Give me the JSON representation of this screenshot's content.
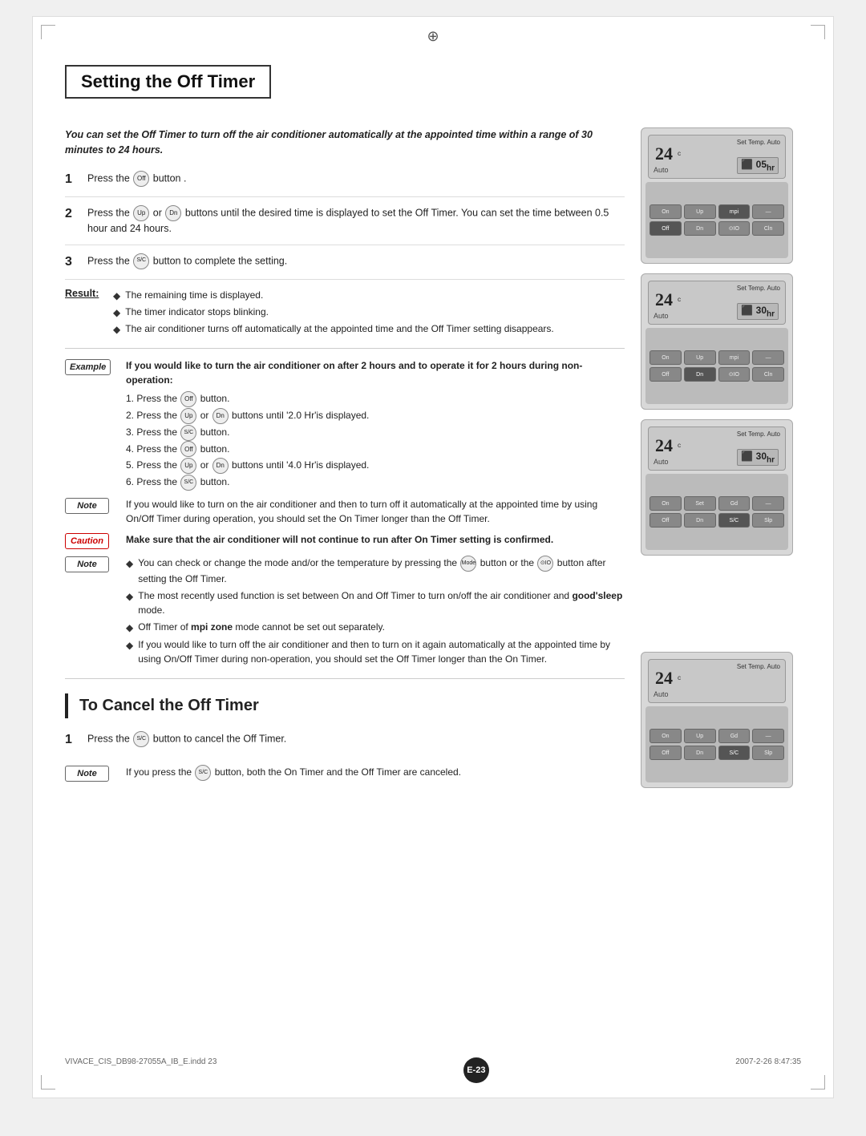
{
  "page": {
    "top_dot": "⊕",
    "section1": {
      "title": "Setting the Off Timer",
      "intro": "You can set the Off Timer to turn off the air conditioner automatically at the appointed time within a range of 30 minutes to 24 hours.",
      "steps": [
        {
          "num": "1",
          "text": "Press the  button ."
        },
        {
          "num": "2",
          "text": "Press the  or  buttons until the desired time is displayed to set the Off Timer. You can set the time between 0.5 hour and 24 hours."
        },
        {
          "num": "3",
          "text": "Press the  button to complete the setting."
        }
      ],
      "result_label": "Result:",
      "result_items": [
        "The remaining time is displayed.",
        "The timer indicator stops blinking.",
        "The air conditioner turns off automatically at the appointed time and the Off Timer setting disappears."
      ],
      "example_label": "Example",
      "example_title": "If you would like to turn the air conditioner on after 2 hours and to operate it for 2 hours during non-operation:",
      "example_steps": [
        "1. Press the  button.",
        "2. Press the  or  buttons until '2.0 Hr'is displayed.",
        "3. Press the  button.",
        "4. Press the  button.",
        "5. Press the  or  buttons until '4.0 Hr'is displayed.",
        "6. Press the  button."
      ],
      "note1_label": "Note",
      "note1_text": "If you would like to turn on the air conditioner and then to turn off it automatically at the appointed time by using On/Off Timer during operation, you should set the On Timer longer than the Off Timer.",
      "caution_label": "Caution",
      "caution_text": "Make sure that the air conditioner will not continue to run after On Timer setting is confirmed.",
      "note2_label": "Note",
      "note2_items": [
        "You can check or change the mode and/or the temperature by pressing the  button or the  button after setting the Off Timer.",
        "The most recently used function is set between On and Off Timer to turn on/off the air conditioner and good'sleep mode.",
        "Off Timer of mpi zone mode cannot be set out separately.",
        "If you would like to turn off the air conditioner and then to turn on it again automatically at the appointed time by using On/Off Timer during non-operation, you should set the Off Timer longer than the On Timer."
      ]
    },
    "section2": {
      "title": "To Cancel the Off Timer",
      "steps": [
        {
          "num": "1",
          "text": "Press the  button to cancel the Off Timer."
        }
      ],
      "note_label": "Note",
      "note_text": "If you press the  button, both the On Timer and the Off Timer are canceled."
    },
    "remotes": [
      {
        "id": "remote1",
        "screen_label": "Auto",
        "temp": "24",
        "temp_unit": "c",
        "mode": "Auto",
        "timer": "05hr",
        "auto_label": "Auto"
      },
      {
        "id": "remote2",
        "screen_label": "Auto",
        "temp": "24",
        "temp_unit": "c",
        "mode": "Auto",
        "timer": "30hr",
        "auto_label": "Auto"
      },
      {
        "id": "remote3",
        "screen_label": "Auto",
        "temp": "24",
        "temp_unit": "c",
        "mode": "Auto",
        "timer": "30hr",
        "auto_label": "Auto"
      },
      {
        "id": "remote4",
        "screen_label": "Auto",
        "temp": "24",
        "temp_unit": "c",
        "mode": "Auto",
        "timer": "",
        "auto_label": "Auto"
      }
    ],
    "footer": {
      "file": "VIVACE_CIS_DB98-27055A_IB_E.indd  23",
      "date": "2007-2-26  8:47:35",
      "page_num": "E-23"
    }
  }
}
